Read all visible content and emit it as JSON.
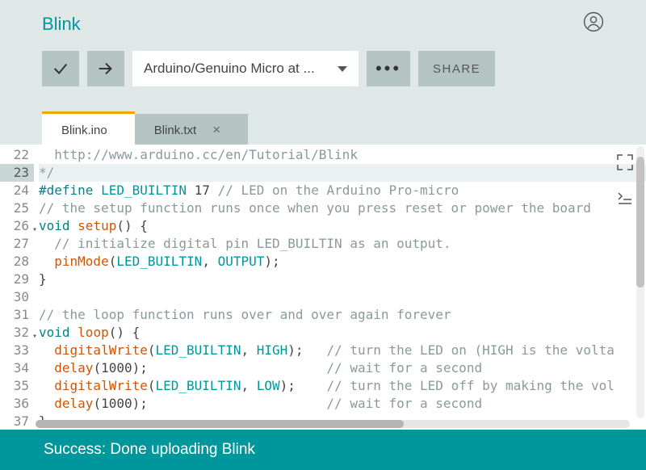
{
  "title": "Blink",
  "toolbar": {
    "board": "Arduino/Genuino Micro at ...",
    "share": "SHARE"
  },
  "tabs": [
    {
      "label": "Blink.ino",
      "active": true,
      "closable": false
    },
    {
      "label": "Blink.txt",
      "active": false,
      "closable": true
    }
  ],
  "gutter_start": 22,
  "code": [
    {
      "n": 22,
      "hl": false,
      "fold": false,
      "html": "  <span class='cm'>http://www.arduino.cc/en/Tutorial/Blink</span>"
    },
    {
      "n": 23,
      "hl": true,
      "fold": false,
      "html": "<span class='cm'>*/</span>"
    },
    {
      "n": 24,
      "hl": false,
      "fold": false,
      "html": "<span class='kw'>#define</span> <span class='id'>LED_BUILTIN</span> <span class='pl'>17</span> <span class='cm'>// LED on the Arduino Pro-micro</span>"
    },
    {
      "n": 25,
      "hl": false,
      "fold": false,
      "html": "<span class='cm'>// the setup function runs once when you press reset or power the board</span>"
    },
    {
      "n": 26,
      "hl": false,
      "fold": true,
      "html": "<span class='kw'>void</span> <span class='fn'>setup</span><span class='pl'>() {</span>"
    },
    {
      "n": 27,
      "hl": false,
      "fold": false,
      "html": "  <span class='cm'>// initialize digital pin LED_BUILTIN as an output.</span>"
    },
    {
      "n": 28,
      "hl": false,
      "fold": false,
      "html": "  <span class='fn'>pinMode</span><span class='pl'>(</span><span class='id'>LED_BUILTIN</span><span class='pl'>, </span><span class='id'>OUTPUT</span><span class='pl'>);</span>"
    },
    {
      "n": 29,
      "hl": false,
      "fold": false,
      "html": "<span class='pl'>}</span>"
    },
    {
      "n": 30,
      "hl": false,
      "fold": false,
      "html": ""
    },
    {
      "n": 31,
      "hl": false,
      "fold": false,
      "html": "<span class='cm'>// the loop function runs over and over again forever</span>"
    },
    {
      "n": 32,
      "hl": false,
      "fold": true,
      "html": "<span class='kw'>void</span> <span class='fn'>loop</span><span class='pl'>() {</span>"
    },
    {
      "n": 33,
      "hl": false,
      "fold": false,
      "html": "  <span class='fn'>digitalWrite</span><span class='pl'>(</span><span class='id'>LED_BUILTIN</span><span class='pl'>, </span><span class='id'>HIGH</span><span class='pl'>);   </span><span class='cm'>// turn the LED on (HIGH is the volta</span>"
    },
    {
      "n": 34,
      "hl": false,
      "fold": false,
      "html": "  <span class='fn'>delay</span><span class='pl'>(1000);                       </span><span class='cm'>// wait for a second</span>"
    },
    {
      "n": 35,
      "hl": false,
      "fold": false,
      "html": "  <span class='fn'>digitalWrite</span><span class='pl'>(</span><span class='id'>LED_BUILTIN</span><span class='pl'>, </span><span class='id'>LOW</span><span class='pl'>);    </span><span class='cm'>// turn the LED off by making the vol</span>"
    },
    {
      "n": 36,
      "hl": false,
      "fold": false,
      "html": "  <span class='fn'>delay</span><span class='pl'>(1000);                       </span><span class='cm'>// wait for a second</span>"
    },
    {
      "n": 37,
      "hl": false,
      "fold": false,
      "html": "<span class='pl'>}</span>"
    }
  ],
  "status": "Success: Done uploading Blink"
}
